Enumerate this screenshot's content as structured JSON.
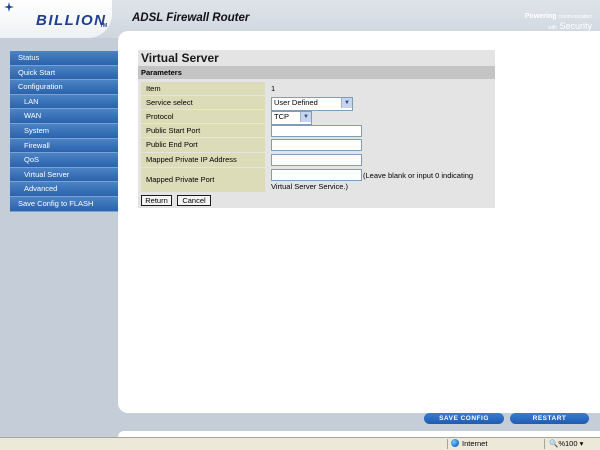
{
  "header": {
    "logo_text": "BILLION",
    "logo_tm": "TM",
    "product_title": "ADSL Firewall Router",
    "powering_line1_bold": "Powering",
    "powering_line1_small": "communication",
    "powering_line2_small": "with",
    "powering_line2": "Security"
  },
  "sidebar": {
    "items": [
      {
        "label": "Status",
        "level": 0
      },
      {
        "label": "Quick Start",
        "level": 0
      },
      {
        "label": "Configuration",
        "level": 0
      },
      {
        "label": "LAN",
        "level": 1
      },
      {
        "label": "WAN",
        "level": 1
      },
      {
        "label": "System",
        "level": 1
      },
      {
        "label": "Firewall",
        "level": 1
      },
      {
        "label": "QoS",
        "level": 1
      },
      {
        "label": "Virtual Server",
        "level": 1
      },
      {
        "label": "Advanced",
        "level": 1
      },
      {
        "label": "Save Config to FLASH",
        "level": 0
      }
    ]
  },
  "form": {
    "title": "Virtual Server",
    "section": "Parameters",
    "item_label": "Item",
    "item_value": "1",
    "service_label": "Service select",
    "service_value": "User Defined",
    "protocol_label": "Protocol",
    "protocol_value": "TCP",
    "public_start_label": "Public Start Port",
    "public_start_value": "",
    "public_end_label": "Public End Port",
    "public_end_value": "",
    "mapped_ip_label": "Mapped Private IP Address",
    "mapped_ip_value": "",
    "mapped_port_label": "Mapped Private Port",
    "mapped_port_value": "",
    "mapped_port_note_1": "(Leave blank or input 0 indicating",
    "mapped_port_note_2": "Virtual Server Service.)",
    "return_label": "Return",
    "cancel_label": "Cancel"
  },
  "footer": {
    "save_config_label": "SAVE CONFIG",
    "restart_label": "RESTART"
  },
  "statusbar": {
    "zone": "Internet",
    "zoom": "%100"
  },
  "colors": {
    "nav_blue": "#2a62ad",
    "label_bg": "#dcdcb8",
    "form_bg": "#e4e4e4",
    "page_bg": "#c5cdd8"
  }
}
